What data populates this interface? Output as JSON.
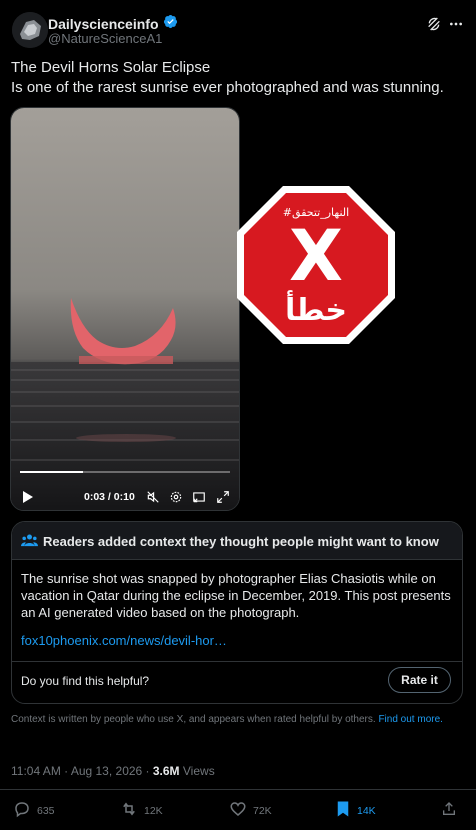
{
  "account": {
    "display_name": "Dailyscienceinfo",
    "handle": "@NatureScienceA1",
    "verified_color": "#1d9bf0"
  },
  "tweet": {
    "line1": "The Devil Horns Solar Eclipse",
    "line2": "Is one of the rarest sunrise ever photographed and was stunning."
  },
  "video": {
    "time_display": "0:03 / 0:10",
    "progress": 0.3
  },
  "stamp": {
    "hashtag": "#النهار_تتحقق",
    "verdict_word": "خطأ",
    "symbol": "X",
    "color": "#d71920"
  },
  "community_note": {
    "header": "Readers added context they thought people might want to know",
    "body": "The sunrise shot was snapped by photographer Elias Chasiotis while on vacation in Qatar during the eclipse in December, 2019. This post presents an AI generated video based on the photograph.",
    "link": "fox10phoenix.com/news/devil-hor…",
    "helpful_question": "Do you find this helpful?",
    "rate_label": "Rate it"
  },
  "context_disclaimer": {
    "text": "Context is written by people who use X, and appears when rated helpful by others.",
    "link": "Find out more."
  },
  "meta": {
    "timestamp": "11:04 AM · Aug 13, 2026 · ",
    "views_count": "3.6M",
    "views_label": " Views"
  },
  "actions": {
    "replies": "635",
    "reposts": "12K",
    "likes": "72K",
    "bookmarks": "14K"
  },
  "colors": {
    "background": "#000000",
    "text": "#e7e9ea",
    "muted": "#71767b",
    "accent": "#1d9bf0",
    "border": "#2f3336"
  }
}
